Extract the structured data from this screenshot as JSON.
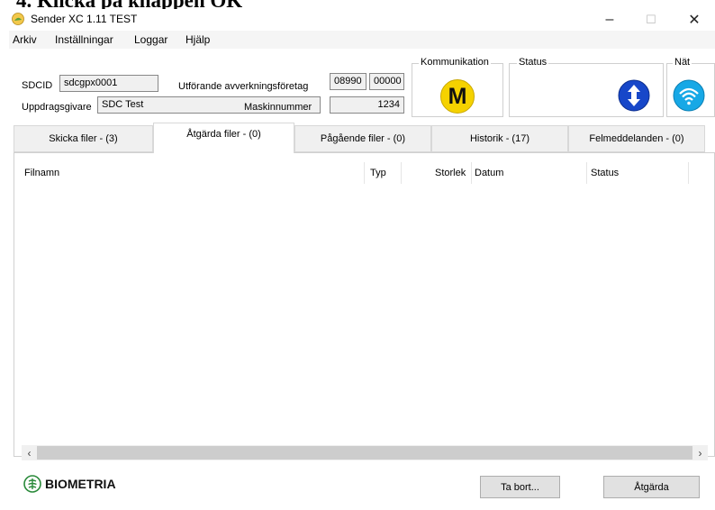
{
  "document": {
    "caption": "4. Klicka på knappen OK"
  },
  "window": {
    "title": "Sender XC 1.11   TEST",
    "controls": {
      "minimize": "–",
      "maximize": "☐",
      "close": "✕"
    }
  },
  "menu": [
    "Arkiv",
    "Inställningar",
    "Loggar",
    "Hjälp"
  ],
  "info": {
    "sdcid_label": "SDCID",
    "sdcid_value": "sdcgpx0001",
    "uppdragsgivare_label": "Uppdragsgivare",
    "uppdragsgivare_value": "SDC Test",
    "utforande_label": "Utförande avverkningsföretag",
    "utforande_code1": "08990",
    "utforande_code2": "00000",
    "maskin_label": "Maskinnummer",
    "maskin_value": "1234"
  },
  "groups": {
    "kommunikation": "Kommunikation",
    "status": "Status",
    "nat": "Nät",
    "kommunikation_icon_letter": "M"
  },
  "tabs": [
    "Skicka filer - (3)",
    "Åtgärda filer - (0)",
    "Pågående filer - (0)",
    "Historik - (17)",
    "Felmeddelanden - (0)"
  ],
  "active_tab": "Åtgärda filer - (0)",
  "table": {
    "columns": [
      "Filnamn",
      "Typ",
      "Storlek",
      "Datum",
      "Status"
    ]
  },
  "footer": {
    "logo_text": "BIOMETRIA",
    "ta_bort": "Ta bort...",
    "atgarda": "Åtgärda"
  },
  "colors": {
    "kommunikation_icon": "#f5d200",
    "status_icon": "#1747c9",
    "nat_icon": "#17a8e6"
  }
}
